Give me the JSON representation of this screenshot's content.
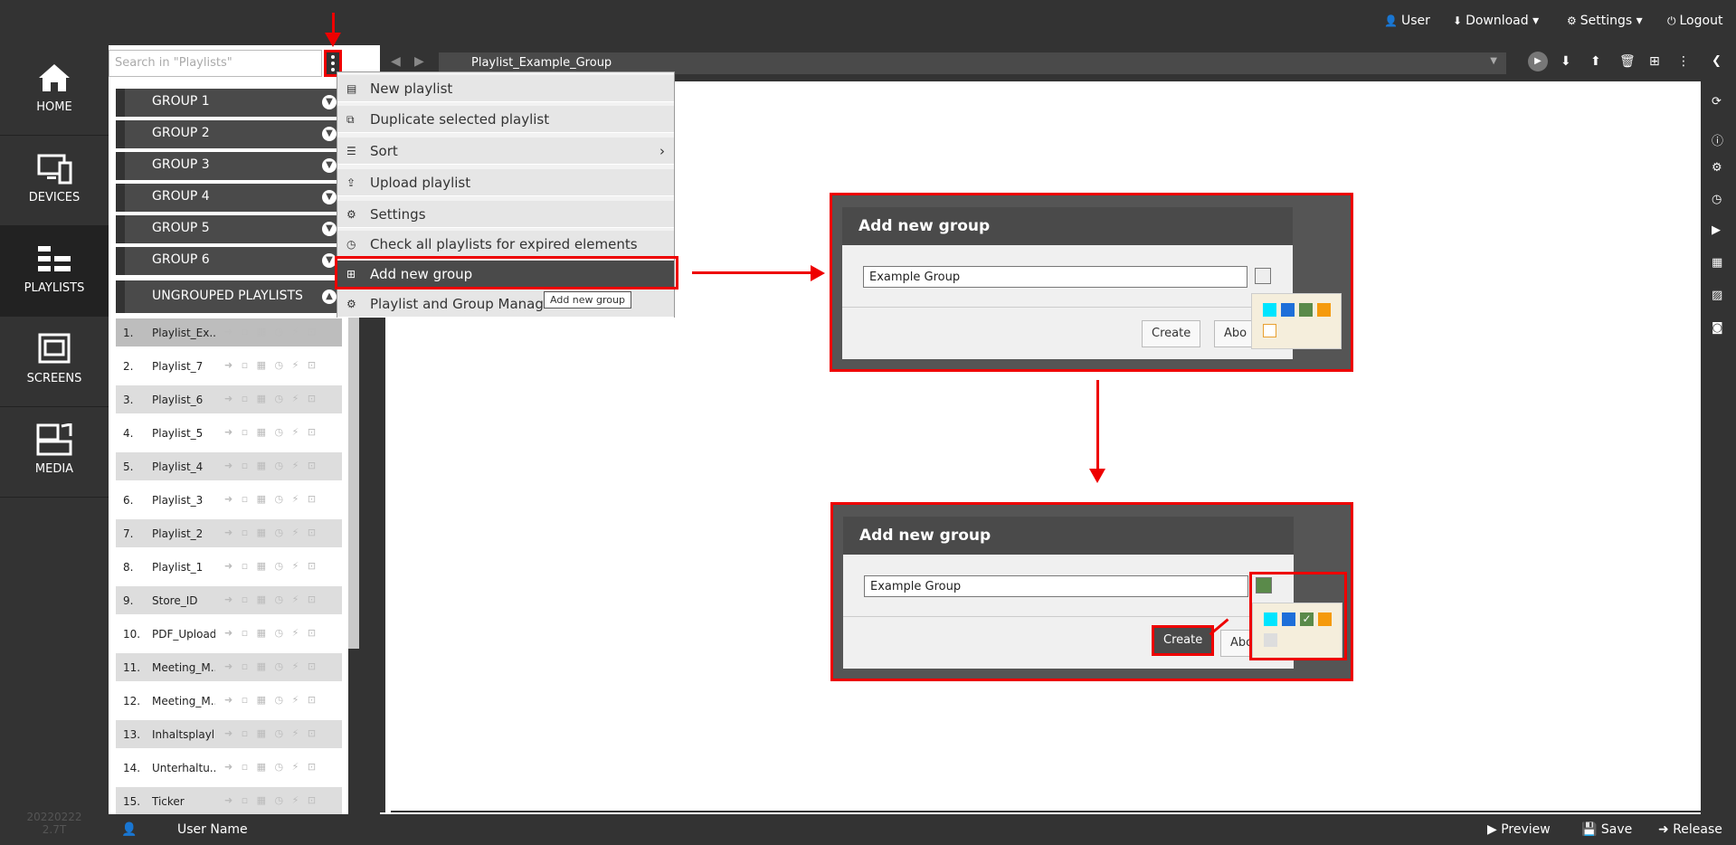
{
  "topbar": {
    "user": "User",
    "download": "Download",
    "settings": "Settings",
    "logout": "Logout"
  },
  "nav": {
    "items": [
      {
        "label": "HOME",
        "icon": "home-icon"
      },
      {
        "label": "DEVICES",
        "icon": "devices-icon"
      },
      {
        "label": "PLAYLISTS",
        "icon": "playlists-icon"
      },
      {
        "label": "SCREENS",
        "icon": "screens-icon"
      },
      {
        "label": "MEDIA",
        "icon": "media-icon"
      }
    ],
    "version_line1": "20220222",
    "version_line2": "2.7T"
  },
  "playlist_panel": {
    "search_placeholder": "Search in \"Playlists\"",
    "groups": [
      "GROUP 1",
      "GROUP 2",
      "GROUP 3",
      "GROUP 4",
      "GROUP 5",
      "GROUP 6"
    ],
    "ungrouped": "UNGROUPED PLAYLISTS",
    "playlists": [
      {
        "num": "1.",
        "name": "Playlist_Ex..."
      },
      {
        "num": "2.",
        "name": "Playlist_7"
      },
      {
        "num": "3.",
        "name": "Playlist_6"
      },
      {
        "num": "4.",
        "name": "Playlist_5"
      },
      {
        "num": "5.",
        "name": "Playlist_4"
      },
      {
        "num": "6.",
        "name": "Playlist_3"
      },
      {
        "num": "7.",
        "name": "Playlist_2"
      },
      {
        "num": "8.",
        "name": "Playlist_1"
      },
      {
        "num": "9.",
        "name": "Store_ID"
      },
      {
        "num": "10.",
        "name": "PDF_Upload"
      },
      {
        "num": "11.",
        "name": "Meeting_M..."
      },
      {
        "num": "12.",
        "name": "Meeting_M..."
      },
      {
        "num": "13.",
        "name": "Inhaltsplayl..."
      },
      {
        "num": "14.",
        "name": "Unterhaltu..."
      },
      {
        "num": "15.",
        "name": "Ticker"
      }
    ]
  },
  "menu": {
    "items": [
      {
        "label": "New playlist",
        "icon": "new-playlist-icon",
        "glyph": "▤"
      },
      {
        "label": "Duplicate selected playlist",
        "icon": "duplicate-icon",
        "glyph": "⧉"
      },
      {
        "label": "Sort",
        "icon": "sort-icon",
        "glyph": "☰"
      },
      {
        "label": "Upload playlist",
        "icon": "upload-icon",
        "glyph": "⇪"
      },
      {
        "label": "Settings",
        "icon": "gear-icon",
        "glyph": "⚙"
      },
      {
        "label": "Check all playlists for expired elements",
        "icon": "clock-icon",
        "glyph": "◷"
      },
      {
        "label": "Add new group",
        "icon": "add-group-icon",
        "glyph": "⊞"
      },
      {
        "label": "Playlist and Group Manag",
        "icon": "manage-icon",
        "glyph": "⚙"
      }
    ],
    "tooltip": "Add new group"
  },
  "editor": {
    "playlist_title": "Playlist_Example_Group"
  },
  "bottombar": {
    "user_name": "User Name",
    "preview": "Preview",
    "save": "Save",
    "release": "Release"
  },
  "dialog1": {
    "title": "Add new group",
    "input_value": "Example Group",
    "create": "Create",
    "abort": "Abo"
  },
  "dialog2": {
    "title": "Add new group",
    "input_value": "Example Group",
    "create": "Create",
    "abort": "Abo"
  },
  "colors": {
    "accent_red": "#ee0000",
    "palette": [
      "#00e5ff",
      "#1e6fd9",
      "#5a8a4a",
      "#f59a0c"
    ]
  }
}
